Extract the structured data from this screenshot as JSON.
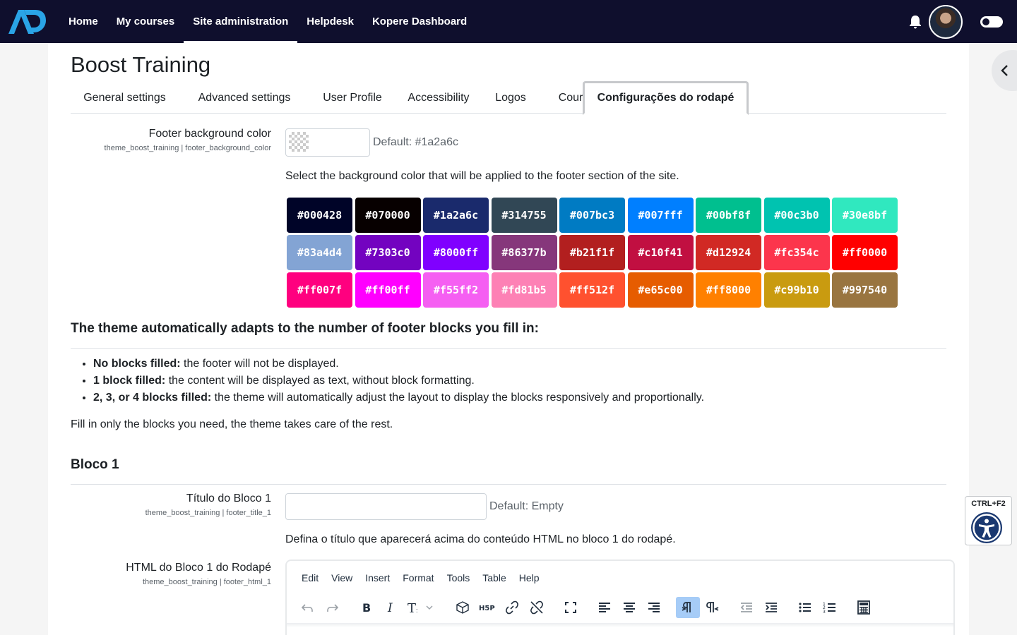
{
  "nav": {
    "items": [
      "Home",
      "My courses",
      "Site administration",
      "Helpdesk",
      "Kopere Dashboard"
    ],
    "active_index": 2
  },
  "page": {
    "title": "Boost Training"
  },
  "tabs": [
    "General settings",
    "Advanced settings",
    "User Profile",
    "Accessibility",
    "Logos",
    "Course",
    "Configurações do rodapé"
  ],
  "footer_bg": {
    "label": "Footer background color",
    "key": "theme_boost_training | footer_background_color",
    "default": "Default: #1a2a6c",
    "description": "Select the background color that will be applied to the footer section of the site."
  },
  "swatches": [
    "#000428",
    "#070000",
    "#1a2a6c",
    "#314755",
    "#007bc3",
    "#007fff",
    "#00bf8f",
    "#00c3b0",
    "#30e8bf",
    "#83a4d4",
    "#7303c0",
    "#8000ff",
    "#86377b",
    "#b21f1f",
    "#c10f41",
    "#d12924",
    "#fc354c",
    "#ff0000",
    "#ff007f",
    "#ff00ff",
    "#f55ff2",
    "#fd81b5",
    "#ff512f",
    "#e65c00",
    "#ff8000",
    "#c99b10",
    "#997540"
  ],
  "info": {
    "heading": "The theme automatically adapts to the number of footer blocks you fill in:",
    "bullets": [
      {
        "bold": "No blocks filled:",
        "text": " the footer will not be displayed."
      },
      {
        "bold": "1 block filled:",
        "text": " the content will be displayed as text, without block formatting."
      },
      {
        "bold": "2, 3, or 4 blocks filled:",
        "text": " the theme will automatically adjust the layout to display the blocks responsively and proportionally."
      }
    ],
    "note": "Fill in only the blocks you need, the theme takes care of the rest."
  },
  "block1": {
    "heading": "Bloco 1",
    "title_label": "Título do Bloco 1",
    "title_key": "theme_boost_training | footer_title_1",
    "title_value": "",
    "title_default": "Default: Empty",
    "title_description": "Defina o título que aparecerá acima do conteúdo HTML no bloco 1 do rodapé.",
    "html_label": "HTML do Bloco 1 do Rodapé",
    "html_key": "theme_boost_training | footer_html_1"
  },
  "editor": {
    "menu": [
      "Edit",
      "View",
      "Insert",
      "Format",
      "Tools",
      "Table",
      "Help"
    ],
    "tools": [
      "undo-icon",
      "redo-icon",
      "bold-icon",
      "italic-icon",
      "text-style-icon",
      "media-block-icon",
      "h5p-icon",
      "link-icon",
      "unlink-icon",
      "fullscreen-icon",
      "align-left-icon",
      "align-center-icon",
      "align-right-icon",
      "ltr-icon",
      "rtl-icon",
      "outdent-icon",
      "indent-icon",
      "bullet-list-icon",
      "numbered-list-icon",
      "calculator-icon"
    ]
  },
  "a11y": {
    "shortcut": "CTRL+F2"
  },
  "colors": {
    "navbar": "#0f0f2d",
    "logo": "#2aa4e6",
    "active_tool": "#a6ccf7"
  }
}
